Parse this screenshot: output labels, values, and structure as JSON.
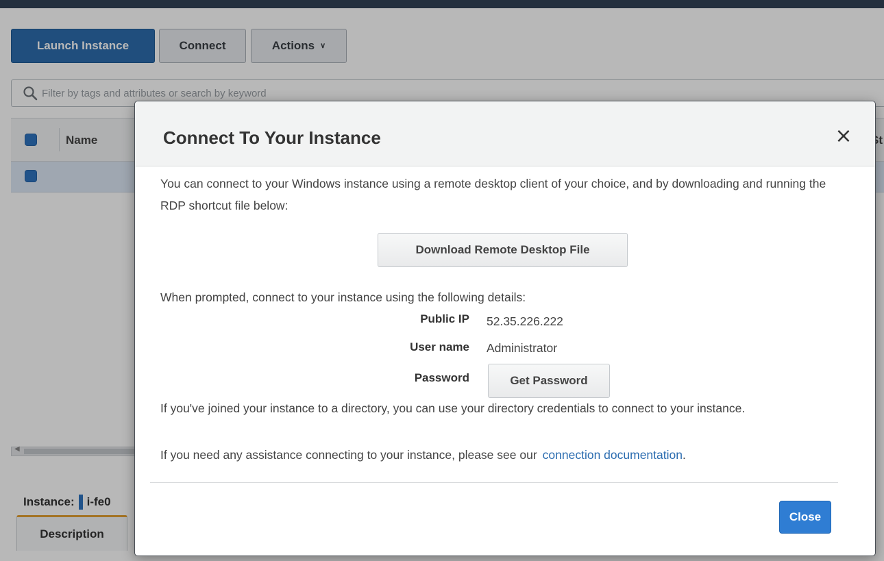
{
  "toolbar": {
    "launch_label": "Launch Instance",
    "connect_label": "Connect",
    "actions_label": "Actions",
    "actions_chevron": "∨"
  },
  "filter": {
    "placeholder": "Filter by tags and attributes or search by keyword",
    "icon": "search-icon"
  },
  "table": {
    "columns": [
      "Name",
      "St"
    ]
  },
  "instance_panel": {
    "label": "Instance:",
    "id_partial": "i-fe0"
  },
  "tabs": [
    "Description"
  ],
  "modal": {
    "title": "Connect To Your Instance",
    "close_icon": "×",
    "intro": "You can connect to your Windows instance using a remote desktop client of your choice, and by downloading and running the RDP shortcut file below:",
    "download_button": "Download Remote Desktop File",
    "prompt": "When prompted, connect to your instance using the following details:",
    "details": {
      "public_ip_label": "Public IP",
      "public_ip": "52.35.226.222",
      "username_label": "User name",
      "username": "Administrator",
      "password_label": "Password",
      "get_password_button": "Get Password"
    },
    "directory_note": "If you've joined your instance to a directory, you can use your directory credentials to connect to your instance.",
    "help_prefix": "If you need any assistance connecting to your instance, please see our",
    "help_link": "connection documentation",
    "help_suffix": ".",
    "close_button": "Close"
  },
  "colors": {
    "primary_button": "#2d6dad",
    "modal_close_button": "#2f7dd3",
    "link": "#2b6cb0",
    "checkbox": "#2f73c0",
    "tab_accent": "#e4a033",
    "top_bar": "#232f3e"
  }
}
